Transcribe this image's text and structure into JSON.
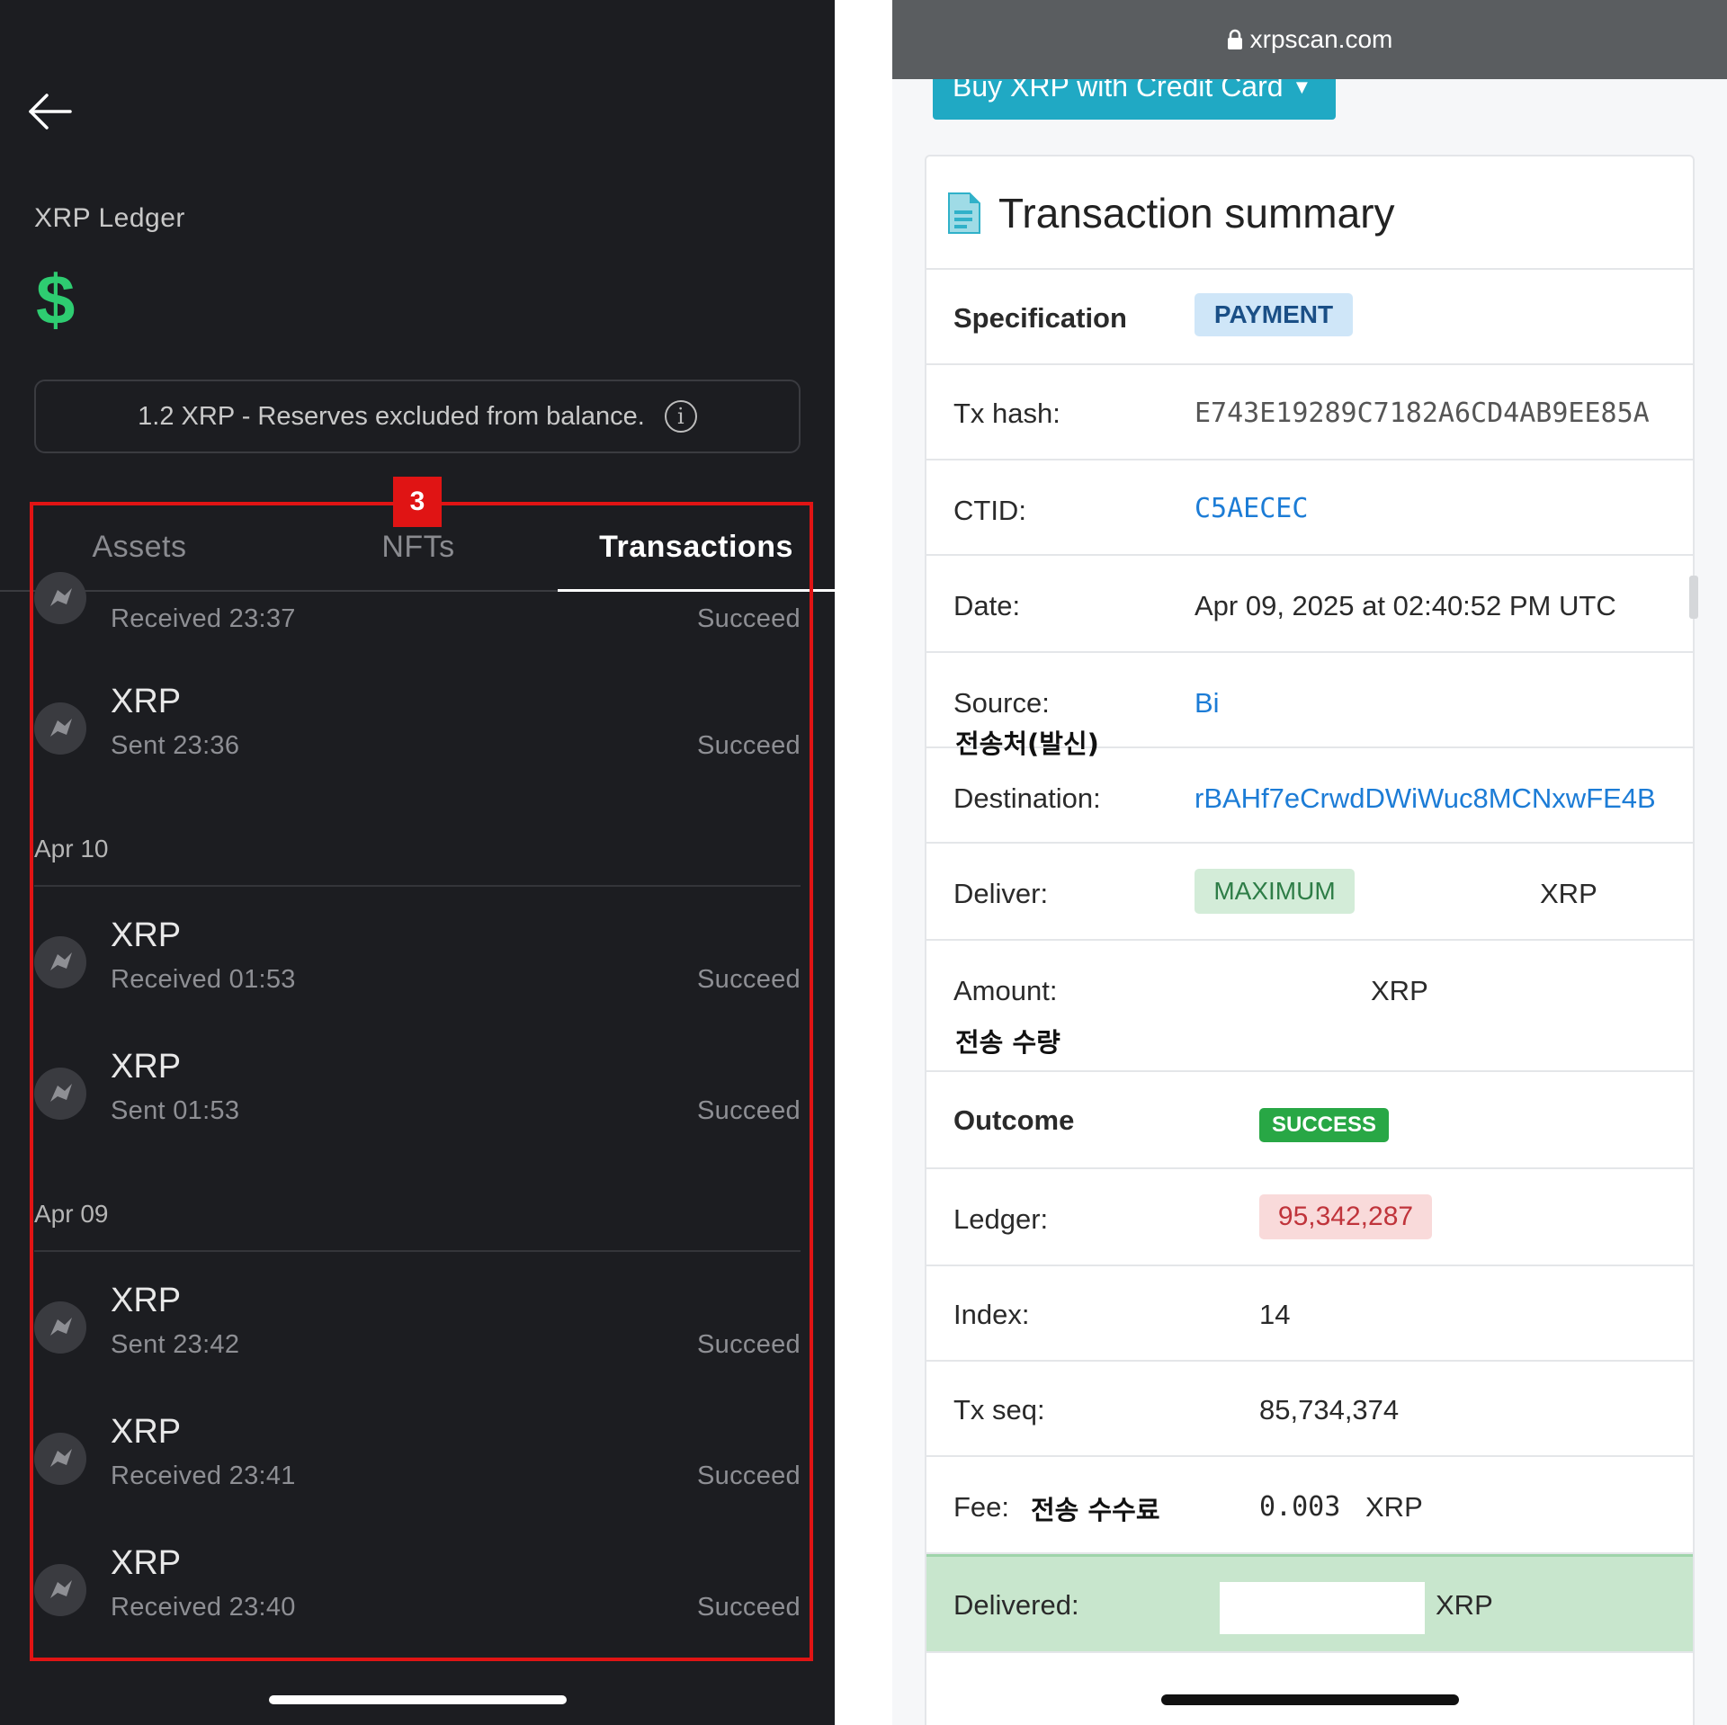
{
  "left_app": {
    "network_name": "XRP Ledger",
    "balance_symbol": "$",
    "reserve_notice": "1.2 XRP - Reserves excluded from balance.",
    "info_glyph": "i",
    "tabs": [
      {
        "label": "Assets",
        "active": false
      },
      {
        "label": "NFTs",
        "active": false
      },
      {
        "label": "Transactions",
        "active": true
      }
    ],
    "annotation_marker": "3",
    "highlight_color": "#e01414",
    "accent_color": "#2ecc71",
    "transactions_top": [
      {
        "sub": "Received 23:37",
        "status": "Succeed"
      },
      {
        "asset": "XRP",
        "sub": "Sent 23:36",
        "status": "Succeed"
      }
    ],
    "groups": [
      {
        "date": "Apr 10",
        "items": [
          {
            "asset": "XRP",
            "sub": "Received 01:53",
            "status": "Succeed"
          },
          {
            "asset": "XRP",
            "sub": "Sent 01:53",
            "status": "Succeed"
          }
        ]
      },
      {
        "date": "Apr 09",
        "items": [
          {
            "asset": "XRP",
            "sub": "Sent 23:42",
            "status": "Succeed"
          },
          {
            "asset": "XRP",
            "sub": "Received 23:41",
            "status": "Succeed"
          },
          {
            "asset": "XRP",
            "sub": "Received 23:40",
            "status": "Succeed"
          }
        ]
      }
    ]
  },
  "right_page": {
    "url": "xrpscan.com",
    "buy_button": "Buy XRP with Credit Card",
    "card_title": "Transaction summary",
    "specification": {
      "label": "Specification",
      "badge": "PAYMENT"
    },
    "tx_hash": {
      "label": "Tx hash:",
      "value": "E743E19289C7182A6CD4AB9EE85A"
    },
    "ctid": {
      "label": "CTID:",
      "value": "C5AECEC"
    },
    "date": {
      "label": "Date:",
      "value": "Apr 09, 2025 at 02:40:52 PM UTC"
    },
    "source": {
      "label": "Source:",
      "value": "Bi",
      "note": "전송처(발신)"
    },
    "destination": {
      "label": "Destination:",
      "value": "rBAHf7eCrwdDWiWuc8MCNxwFE4B"
    },
    "deliver": {
      "label": "Deliver:",
      "badge": "MAXIMUM",
      "unit": "XRP"
    },
    "amount": {
      "label": "Amount:",
      "unit": "XRP",
      "note": "전송 수량"
    },
    "outcome": {
      "label": "Outcome",
      "badge": "SUCCESS"
    },
    "ledger": {
      "label": "Ledger:",
      "value": "95,342,287"
    },
    "index": {
      "label": "Index:",
      "value": "14"
    },
    "tx_seq": {
      "label": "Tx seq:",
      "value": "85,734,374"
    },
    "fee": {
      "label": "Fee:",
      "note": "전송 수수료",
      "value": "0.003",
      "unit": "XRP"
    },
    "delivered": {
      "label": "Delivered:",
      "unit": "XRP"
    },
    "colors": {
      "link": "#1c7cd6",
      "success": "#28a745",
      "delivered_bg": "#c8e6cd",
      "button": "#20a9c4"
    }
  }
}
